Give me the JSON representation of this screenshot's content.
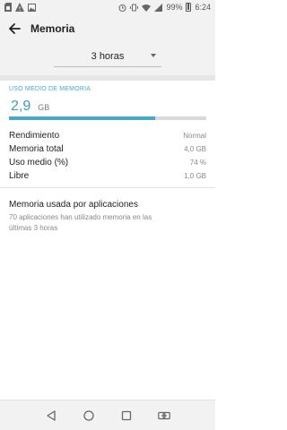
{
  "status_bar": {
    "left_icons": [
      "sim-icon",
      "warning-icon",
      "image-icon"
    ],
    "right_icons": [
      "alarm-icon",
      "vibrate-icon",
      "wifi-icon",
      "signal-icon"
    ],
    "battery": "99%",
    "time": "6:24"
  },
  "app_bar": {
    "title": "Memoria",
    "back_icon": "arrow-back-icon"
  },
  "period": {
    "selected": "3 horas"
  },
  "usage": {
    "section_title": "USO MEDIO DE MEMORIA",
    "value": "2,9",
    "unit": "GB",
    "fill_fraction": 0.74
  },
  "stats": [
    {
      "label": "Rendimiento",
      "value": "Normal"
    },
    {
      "label": "Memoria total",
      "value": "4,0 GB"
    },
    {
      "label": "Uso medio (%)",
      "value": "74 %"
    },
    {
      "label": "Libre",
      "value": "1,0 GB"
    }
  ],
  "apps": {
    "title": "Memoria usada por aplicaciones",
    "desc_line1": "70 aplicaciones han utilizado memoria en las",
    "desc_line2": "últimas 3 horas"
  },
  "nav_bar": {
    "buttons": [
      "back-triangle-icon",
      "home-circle-icon",
      "recents-square-icon",
      "switch-apps-icon"
    ]
  },
  "colors": {
    "accent": "#4aa8c4",
    "bar_background": "#f2f2f2"
  }
}
